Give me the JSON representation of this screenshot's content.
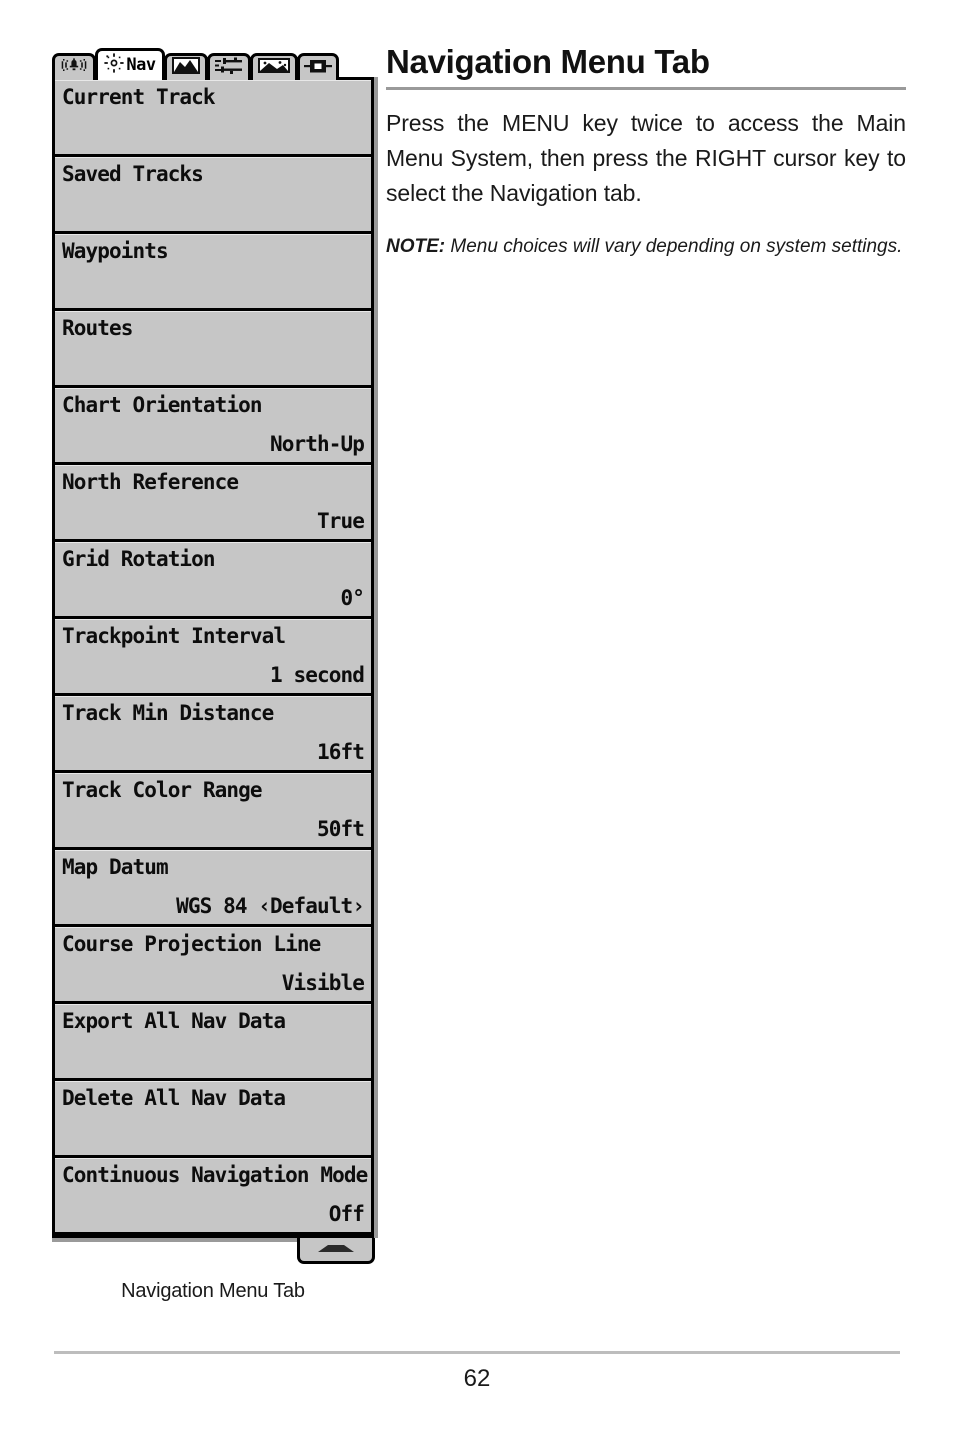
{
  "document": {
    "page_number": "62"
  },
  "content": {
    "title": "Navigation Menu Tab",
    "paragraph": "Press the MENU key twice to access the Main Menu System, then press the RIGHT cursor key to select the Navigation tab.",
    "note_label": "NOTE:",
    "note_text": " Menu choices will vary depending on system settings."
  },
  "figure": {
    "caption": "Navigation Menu Tab",
    "tabs": [
      {
        "name": "alarm-tab",
        "label": "",
        "icon": "alarm-bell-icon",
        "active": false
      },
      {
        "name": "navigation-tab",
        "label": "Nav",
        "icon": "compass-rose-icon",
        "active": true
      },
      {
        "name": "chart-tab",
        "label": "",
        "icon": "chart-map-icon",
        "active": false
      },
      {
        "name": "setup-tab",
        "label": "",
        "icon": "wrench-sliders-icon",
        "active": false
      },
      {
        "name": "views-tab",
        "label": "",
        "icon": "views-screen-icon",
        "active": false
      },
      {
        "name": "accessories-tab",
        "label": "",
        "icon": "accessory-module-icon",
        "active": false
      }
    ],
    "menu_items": [
      {
        "label": "Current Track",
        "value": ""
      },
      {
        "label": "Saved Tracks",
        "value": ""
      },
      {
        "label": "Waypoints",
        "value": ""
      },
      {
        "label": "Routes",
        "value": ""
      },
      {
        "label": "Chart Orientation",
        "value": "North-Up"
      },
      {
        "label": "North Reference",
        "value": "True"
      },
      {
        "label": "Grid Rotation",
        "value": "0°"
      },
      {
        "label": "Trackpoint Interval",
        "value": "1 second"
      },
      {
        "label": "Track Min Distance",
        "value": "16ft"
      },
      {
        "label": "Track Color Range",
        "value": "50ft"
      },
      {
        "label": "Map Datum",
        "value": "WGS 84 ‹Default›"
      },
      {
        "label": "Course Projection Line",
        "value": "Visible"
      },
      {
        "label": "Export All Nav Data",
        "value": ""
      },
      {
        "label": "Delete All Nav Data",
        "value": ""
      },
      {
        "label": "Continuous Navigation Mode",
        "value": "Off"
      }
    ],
    "scroll_indicator": "scroll-up-arrow"
  }
}
